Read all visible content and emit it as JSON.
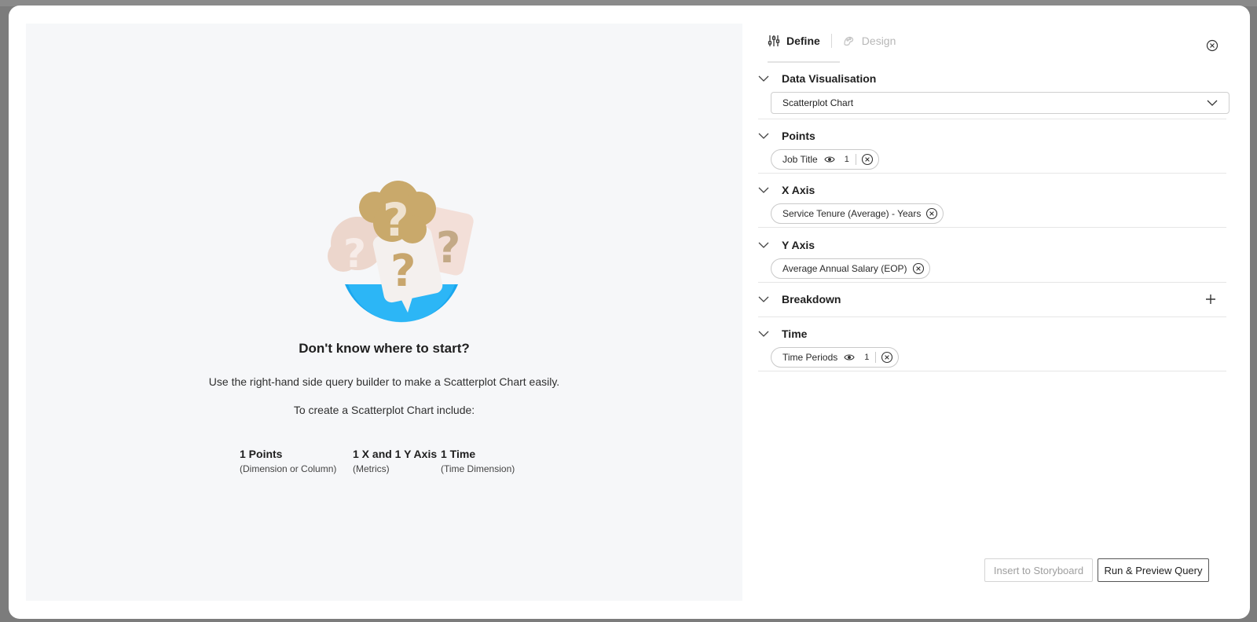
{
  "empty_state": {
    "title": "Don't know where to start?",
    "subtitle": "Use the right-hand side query builder to make a Scatterplot Chart easily.",
    "subtitle2": "To create a Scatterplot Chart include:",
    "requirements": [
      {
        "title": "1 Points",
        "hint": "(Dimension or Column)"
      },
      {
        "title": "1 X and 1 Y Axis",
        "hint": "(Metrics)"
      },
      {
        "title": "1 Time",
        "hint": "(Time Dimension)"
      }
    ]
  },
  "tabs": {
    "define": "Define",
    "design": "Design"
  },
  "sections": {
    "data_visualisation": {
      "title": "Data Visualisation",
      "selected": "Scatterplot Chart"
    },
    "points": {
      "title": "Points",
      "pill_label": "Job Title",
      "pill_count": "1"
    },
    "x_axis": {
      "title": "X Axis",
      "pill_label": "Service Tenure (Average) - Years"
    },
    "y_axis": {
      "title": "Y Axis",
      "pill_label": "Average Annual Salary (EOP)"
    },
    "breakdown": {
      "title": "Breakdown"
    },
    "time": {
      "title": "Time",
      "pill_label": "Time Periods",
      "pill_count": "1"
    }
  },
  "footer": {
    "insert_label": "Insert to Storyboard",
    "run_label": "Run & Preview Query"
  },
  "icons": [
    "sliders-icon",
    "palette-icon",
    "close-circle-icon",
    "chevron-down-icon",
    "eye-icon",
    "remove-circle-icon",
    "plus-icon"
  ],
  "colors": {
    "left_pane_bg": "#f6f7f9",
    "illustration_blue": "#1aa7ee",
    "illustration_gold": "#c9a96b",
    "illustration_pink": "#f1d9d0"
  }
}
